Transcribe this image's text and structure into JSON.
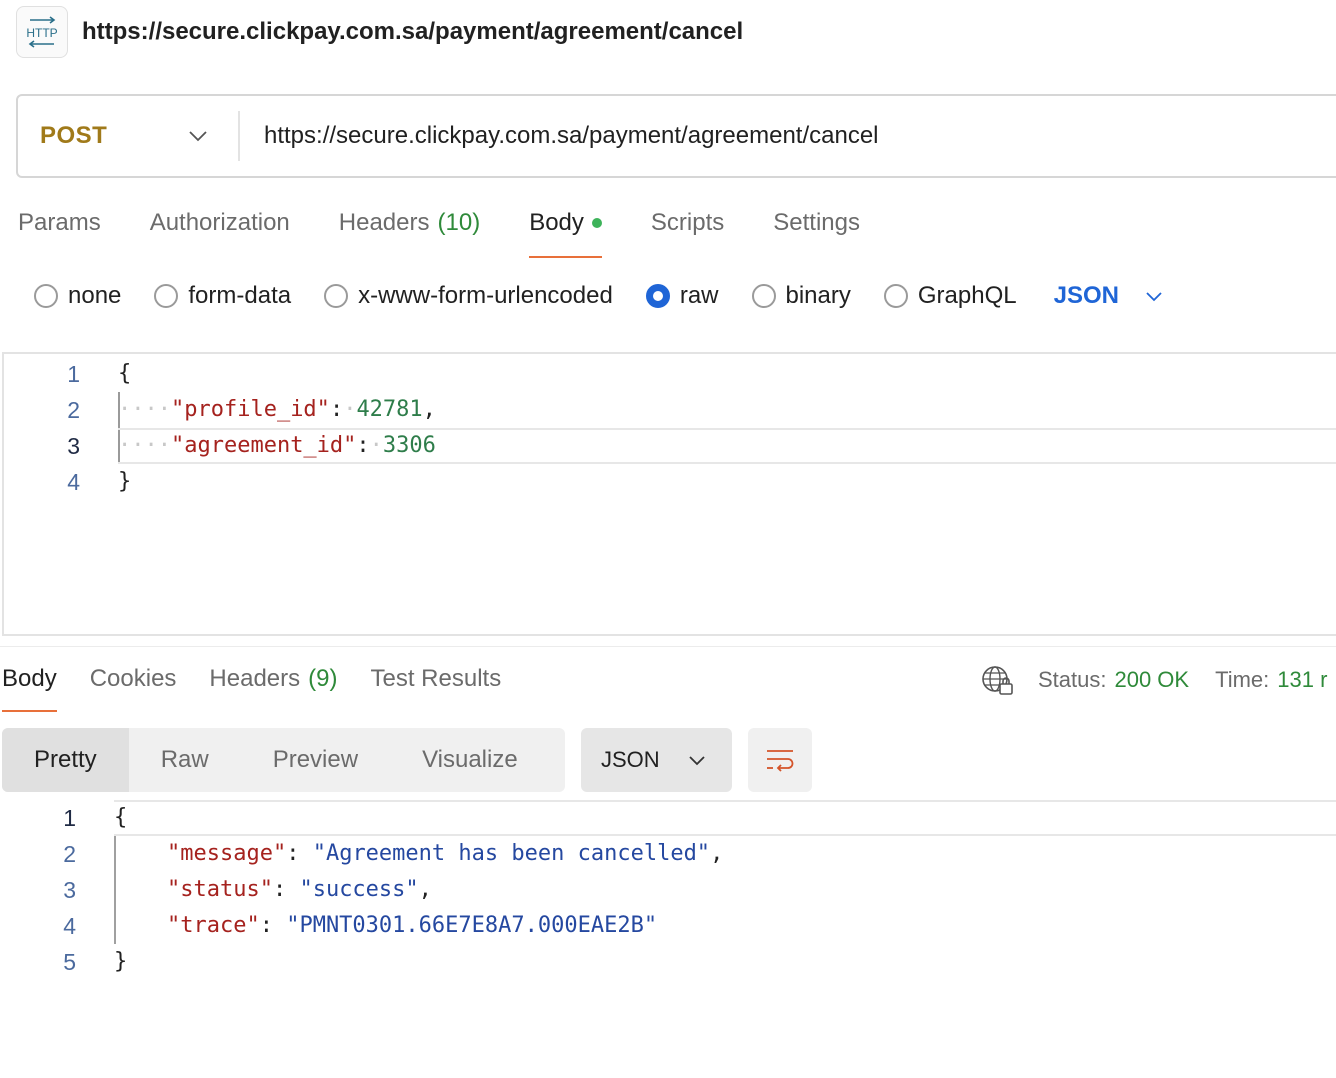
{
  "header": {
    "badge": "HTTP",
    "title": "https://secure.clickpay.com.sa/payment/agreement/cancel"
  },
  "request": {
    "method": "POST",
    "url": "https://secure.clickpay.com.sa/payment/agreement/cancel",
    "tabs": {
      "params": "Params",
      "authorization": "Authorization",
      "headers": "Headers",
      "headers_count": "(10)",
      "body": "Body",
      "scripts": "Scripts",
      "settings": "Settings"
    },
    "body_types": {
      "none": "none",
      "form_data": "form-data",
      "urlencoded": "x-www-form-urlencoded",
      "raw": "raw",
      "binary": "binary",
      "graphql": "GraphQL"
    },
    "selected_body_type": "raw",
    "format": "JSON",
    "lines": {
      "n1": "1",
      "n2": "2",
      "n3": "3",
      "n4": "4",
      "open": "{",
      "key1": "\"profile_id\"",
      "val1": "42781",
      "key2": "\"agreement_id\"",
      "val2": "3306",
      "close": "}"
    }
  },
  "response": {
    "tabs": {
      "body": "Body",
      "cookies": "Cookies",
      "headers": "Headers",
      "headers_count": "(9)",
      "test_results": "Test Results"
    },
    "status_label": "Status:",
    "status_value": "200 OK",
    "time_label": "Time:",
    "time_value": "131 r",
    "views": {
      "pretty": "Pretty",
      "raw": "Raw",
      "preview": "Preview",
      "visualize": "Visualize"
    },
    "format": "JSON",
    "lines": {
      "n1": "1",
      "n2": "2",
      "n3": "3",
      "n4": "4",
      "n5": "5",
      "open": "{",
      "key1": "\"message\"",
      "val1": "\"Agreement has been cancelled\"",
      "key2": "\"status\"",
      "val2": "\"success\"",
      "key3": "\"trace\"",
      "val3": "\"PMNT0301.66E7E8A7.000EAE2B\"",
      "close": "}"
    }
  },
  "colors": {
    "method": "#a07a1a",
    "accent_tab": "#e8703a",
    "success": "#2f8a3a",
    "radio_checked": "#1f65d6",
    "json_key": "#a5221e",
    "json_string": "#2548a0",
    "json_number": "#2e7d4a"
  }
}
